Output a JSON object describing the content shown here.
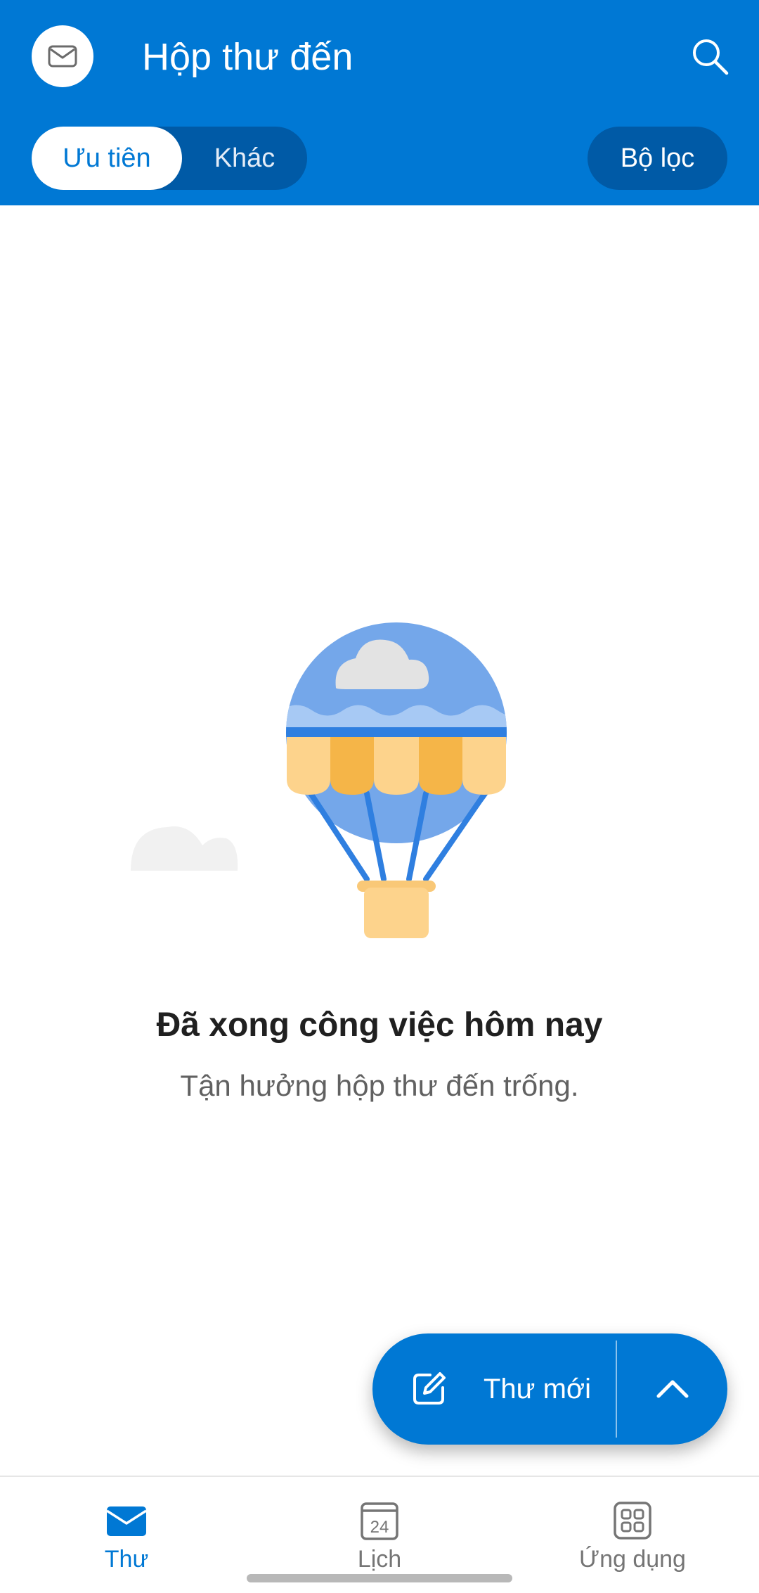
{
  "header": {
    "title": "Hộp thư đến",
    "avatar_icon": "mail-icon",
    "search_icon": "search-icon",
    "tabs": [
      {
        "label": "Ưu tiên",
        "active": true
      },
      {
        "label": "Khác",
        "active": false
      }
    ],
    "filter_label": "Bộ lọc"
  },
  "empty_state": {
    "illustration": "hot-air-balloon",
    "title": "Đã xong công việc hôm nay",
    "subtitle": "Tận hưởng hộp thư đến trống."
  },
  "fab": {
    "label": "Thư mới",
    "icon": "edit-icon",
    "expand_icon": "chevron-up-icon"
  },
  "bottom_nav": {
    "items": [
      {
        "label": "Thư",
        "icon": "mail-icon",
        "active": true
      },
      {
        "label": "Lịch",
        "icon": "calendar-icon",
        "date": "24",
        "active": false
      },
      {
        "label": "Ứng dụng",
        "icon": "apps-icon",
        "active": false
      }
    ]
  },
  "colors": {
    "brand": "#0078d4",
    "brand_dark": "#005aa6",
    "text_primary": "#202020",
    "text_secondary": "#616161",
    "nav_inactive": "#757575"
  }
}
